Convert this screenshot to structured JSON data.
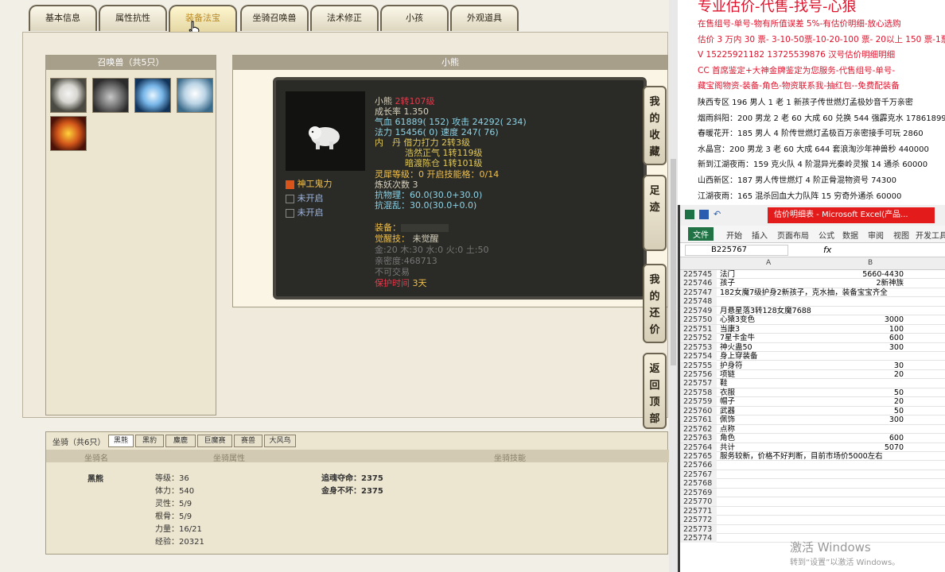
{
  "tabs": [
    "基本信息",
    "属性抗性",
    "装备法宝",
    "坐骑召唤兽",
    "法术修正",
    "小孩",
    "外观道具"
  ],
  "summon": {
    "header": "召唤兽（共5只）"
  },
  "detail": {
    "header": "小熊",
    "name": "小熊",
    "name_extra": "2转107级",
    "growth": "成长率 1.350",
    "hp_label": "气血",
    "hp": "61889( 152)",
    "atk_label": "攻击",
    "atk": "24292( 234)",
    "mp_label": "法力",
    "mp": "15456( 0)",
    "spd_label": "速度",
    "spd": "247( 76)",
    "core_label": "内　丹",
    "core1": "借力打力 2转3级",
    "core2": "浩然正气 1转119级",
    "core3": "暗渡陈仓 1转101级",
    "ling": "灵犀等级：0 开启技能格：0/14",
    "refine": "炼妖次数 3",
    "phys": "抗物理：60.0(30.0+30.0)",
    "chaos": "抗混乱：30.0(30.0+0.0)",
    "equip": "装备：",
    "awaken_label": "觉醒技：",
    "awaken": "未觉醒",
    "elements": "金:20 木:30 水:0 火:0 土:50",
    "intimacy": "亲密度:468713",
    "notrade": "不可交易",
    "protect_label": "保护时间",
    "protect": "3天",
    "skills": [
      "神工鬼力",
      "未开启",
      "未开启"
    ]
  },
  "side_buttons": [
    "我的收藏",
    "足迹",
    "我的还价",
    "返回顶部"
  ],
  "mount": {
    "header": "坐骑（共6只）",
    "tabs": [
      "黑熊",
      "黑豹",
      "麋鹿",
      "巨魔赛",
      "赛兽",
      "大风鸟"
    ],
    "col1": "坐骑名",
    "col2": "坐骑属性",
    "col3": "坐骑技能",
    "name": "黑熊",
    "attrs": [
      "等级：36",
      "体力：540",
      "灵性：5/9",
      "根骨：5/9",
      "力量：16/21",
      "经验：20321"
    ],
    "skills": [
      "追魂夺命：2375",
      "金身不坏：2375"
    ]
  },
  "banner": {
    "title": "专业估价-代售-找号-心狼",
    "lines": [
      {
        "t": "在售组号-单号-物有所值误差 5%-有估价明细-放心选购",
        "c": "#e0142d"
      },
      {
        "t": "估价 3 万内 30 票- 3-10-50票-10-20-100 票- 20以上 150 票-1票",
        "c": "#e0142d"
      },
      {
        "t": "V 15225921182  13725539876 汉号估价明细明细",
        "c": "#e0142d"
      },
      {
        "t": "CC 首席鉴定+大神金牌鉴定为您服务-代售组号-单号-",
        "c": "#e0142d"
      },
      {
        "t": "藏宝阁物资-装备-角色-物资联系我-抽红包--免费配装备",
        "c": "#e0142d"
      },
      {
        "t": "陕西专区 196 男人 1 老 1 新孩子传世燃灯孟极妙音千万亲密",
        "c": "#111"
      },
      {
        "t": "烟雨斜阳：200 男龙 2 老 60 大成 60 兑换 544 强霹克水 17861899",
        "c": "#111"
      },
      {
        "t": "春暖花开：185 男人 4 阶传世燃灯孟极百万亲密接手可玩 2860",
        "c": "#111"
      },
      {
        "t": "水晶宫：200 男龙 3 老 60 大成 644 套浪淘沙年神兽秒 440000",
        "c": "#111"
      },
      {
        "t": "新到江湖夜雨：159 克火队 4 阶混异光秦岭灵猴 14 通杀 60000",
        "c": "#111"
      },
      {
        "t": "山西新区：187 男人传世燃灯 4 阶正骨混物资号 74300",
        "c": "#111"
      },
      {
        "t": "江湖夜雨：165 混杀回血大力队阵 15 穷奇外通杀 60000",
        "c": "#111"
      }
    ]
  },
  "excel": {
    "title": "估价明细表 - Microsoft Excel(产品...",
    "ribbon": [
      "文件",
      "开始",
      "插入",
      "页面布局",
      "公式",
      "数据",
      "审阅",
      "视图",
      "开发工具"
    ],
    "cellref": "B225767",
    "fx": "fx",
    "colA": "A",
    "colB": "B",
    "rows": [
      [
        "225745",
        "法门",
        "5660-4430"
      ],
      [
        "225746",
        "孩子",
        "2新神族"
      ],
      [
        "225747",
        "182女魔7级护身2新孩子，克水抽，装备宝宝齐全",
        ""
      ],
      [
        "225748",
        "",
        ""
      ],
      [
        "225749",
        "月悬星落3转128女魔7688",
        ""
      ],
      [
        "225750",
        "心猿3变色",
        "3000"
      ],
      [
        "225751",
        "当康3",
        "100"
      ],
      [
        "225752",
        "7星卡金牛",
        "600"
      ],
      [
        "225753",
        "神火蛊50",
        "300"
      ],
      [
        "225754",
        "身上穿装备",
        ""
      ],
      [
        "225755",
        "护身符",
        "30"
      ],
      [
        "225756",
        "项链",
        "20"
      ],
      [
        "225757",
        "鞋",
        ""
      ],
      [
        "225758",
        "衣服",
        "50"
      ],
      [
        "225759",
        "帽子",
        "20"
      ],
      [
        "225760",
        "武器",
        "50"
      ],
      [
        "225761",
        "佩饰",
        "300"
      ],
      [
        "225762",
        "点称",
        ""
      ],
      [
        "225763",
        "角色",
        "600"
      ],
      [
        "225764",
        "共计",
        "5070"
      ],
      [
        "225765",
        "服务较新，价格不好判断，目前市场价5000左右",
        ""
      ],
      [
        "225766",
        "",
        ""
      ],
      [
        "225767",
        "",
        ""
      ],
      [
        "225768",
        "",
        ""
      ],
      [
        "225769",
        "",
        ""
      ],
      [
        "225770",
        "",
        ""
      ],
      [
        "225771",
        "",
        ""
      ],
      [
        "225772",
        "",
        ""
      ],
      [
        "225773",
        "",
        ""
      ],
      [
        "225774",
        "",
        ""
      ]
    ]
  },
  "watermark": {
    "line1": "激活 Windows",
    "line2": "转到“设置”以激活 Windows。"
  }
}
